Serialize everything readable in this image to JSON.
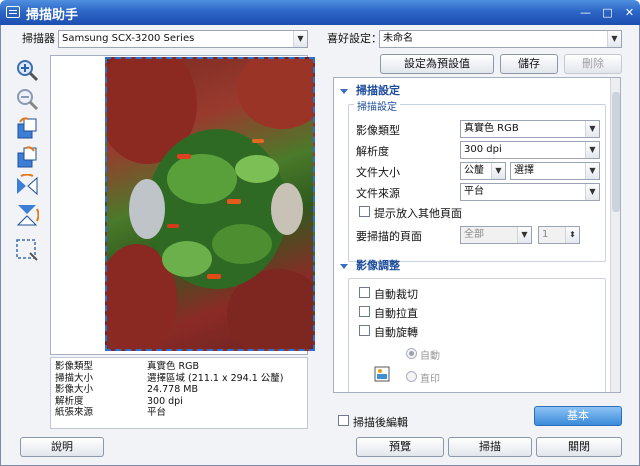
{
  "window": {
    "title": "掃描助手",
    "minimize": "—",
    "maximize": "□",
    "close": "✕"
  },
  "scanner": {
    "label": "掃描器",
    "value": "Samsung SCX-3200 Series"
  },
  "preset": {
    "label": "喜好設定：",
    "value": "未命名",
    "set_default": "設定為預設值",
    "save": "儲存",
    "delete": "刪除"
  },
  "tools": [
    "zoom-in-icon",
    "zoom-out-icon",
    "rotate-left-icon",
    "rotate-right-icon",
    "flip-horizontal-icon",
    "flip-vertical-icon",
    "select-area-icon"
  ],
  "info": [
    {
      "k": "影像類型",
      "v": "真實色 RGB"
    },
    {
      "k": "掃描大小",
      "v": "選擇區域 (211.1 x 294.1 公釐)"
    },
    {
      "k": "影像大小",
      "v": "24.778 MB"
    },
    {
      "k": "解析度",
      "v": "300 dpi"
    },
    {
      "k": "紙張來源",
      "v": "平台"
    }
  ],
  "scan_settings": {
    "section_title": "掃描設定",
    "group_title": "掃描設定",
    "image_type": {
      "label": "影像類型",
      "value": "真實色 RGB"
    },
    "resolution": {
      "label": "解析度",
      "value": "300 dpi"
    },
    "doc_size": {
      "label": "文件大小",
      "unit": "公釐",
      "value": "選擇"
    },
    "doc_source": {
      "label": "文件來源",
      "value": "平台"
    },
    "prompt_more": "提示放入其他頁面",
    "pages": {
      "label": "要掃描的頁面",
      "value": "全部",
      "number": "1"
    }
  },
  "image_adjust": {
    "section_title": "影像調整",
    "auto_crop": "自動裁切",
    "auto_straighten": "自動拉直",
    "auto_rotate": "自動旋轉",
    "radio_auto": "自動",
    "radio_print": "直印"
  },
  "footer": {
    "edit_after_scan": "掃描後編輯",
    "basic": "基本",
    "help": "說明",
    "preview": "預覽",
    "scan": "掃描",
    "close": "關閉"
  },
  "colors": {
    "title_bar": "#2a63c4",
    "accent": "#3b8ad9",
    "section": "#1d4c9c"
  }
}
